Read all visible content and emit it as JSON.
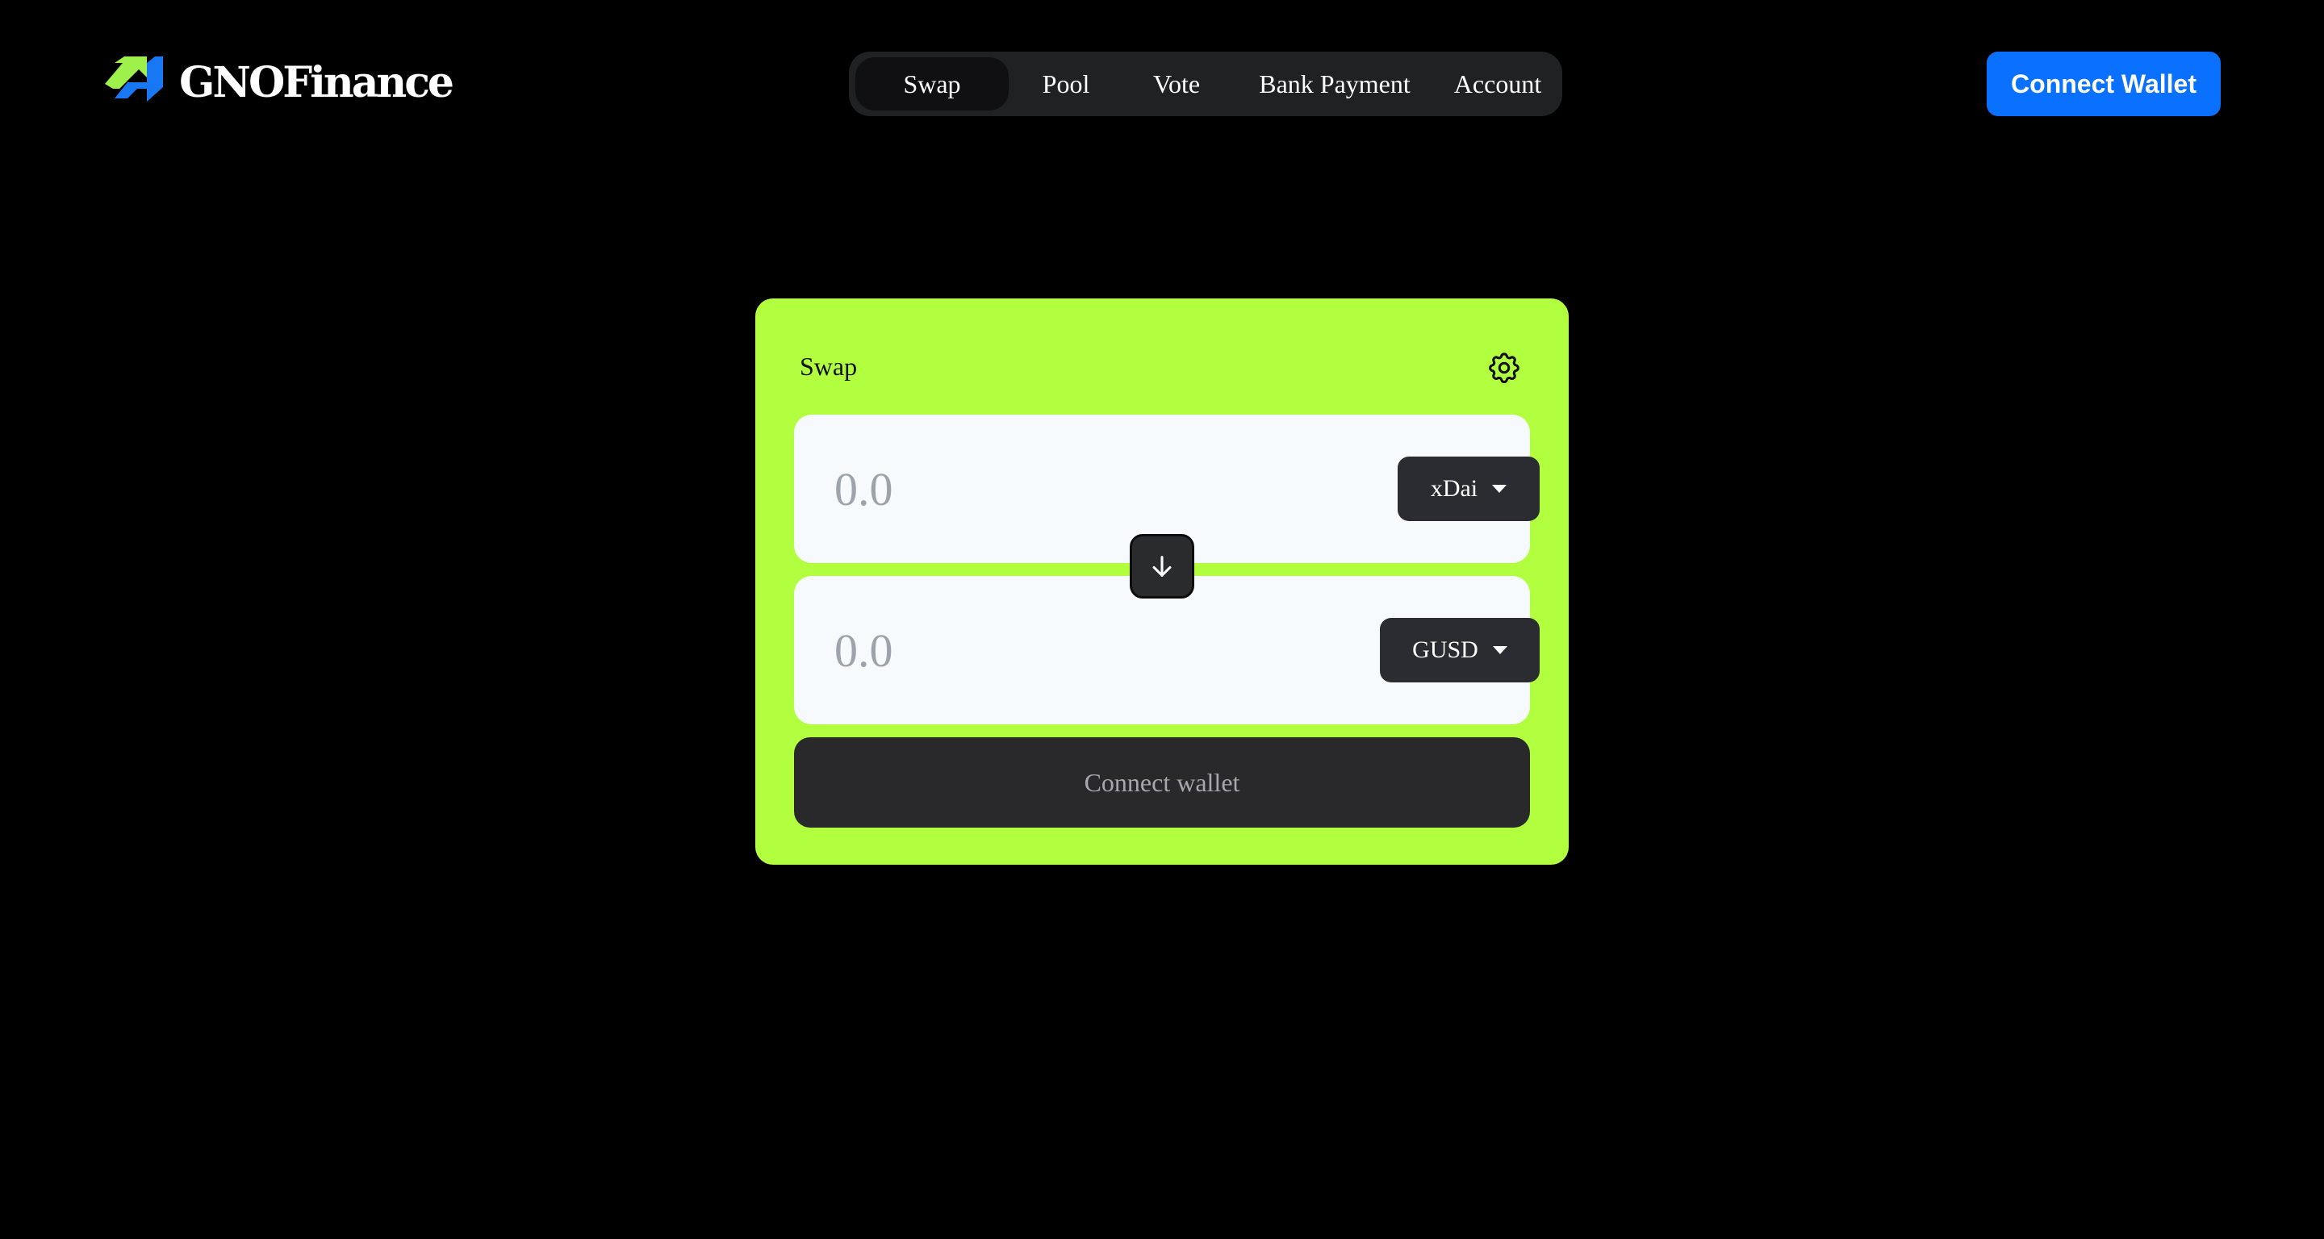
{
  "brand": {
    "name": "GNOFinance",
    "logo_icon": "arrow-up-right-icon",
    "colors": {
      "logo_green": "#9df14a",
      "logo_blue": "#1877f2"
    }
  },
  "nav": {
    "items": [
      {
        "label": "Swap",
        "active": true
      },
      {
        "label": "Pool",
        "active": false
      },
      {
        "label": "Vote",
        "active": false
      },
      {
        "label": "Bank Payment",
        "active": false
      },
      {
        "label": "Account",
        "active": false
      }
    ]
  },
  "header": {
    "connect_wallet_label": "Connect Wallet",
    "connect_wallet_color": "#0a70ff"
  },
  "swap": {
    "title": "Swap",
    "settings_icon": "gear-icon",
    "card_color": "#b2ff40",
    "from": {
      "placeholder": "0.0",
      "value": "",
      "token": "xDai"
    },
    "to": {
      "placeholder": "0.0",
      "value": "",
      "token": "GUSD"
    },
    "direction_icon": "arrow-down-icon",
    "action_label": "Connect wallet"
  }
}
